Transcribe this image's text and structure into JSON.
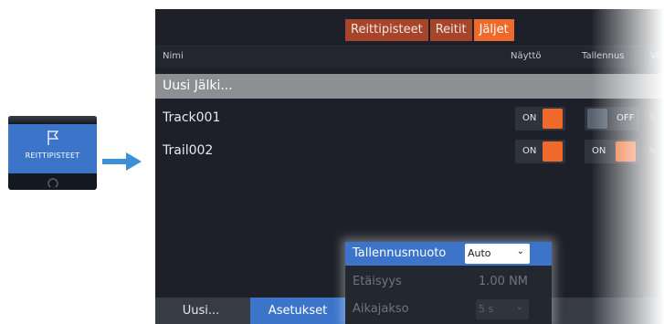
{
  "side_button": {
    "label": "REITTIPISTEET",
    "icon": "flag-icon",
    "accent": "#3b74c9"
  },
  "tabs": [
    {
      "label": "Reittipisteet",
      "active": false
    },
    {
      "label": "Reitit",
      "active": false
    },
    {
      "label": "Jäljet",
      "active": true
    }
  ],
  "columns": {
    "name": "Nimi",
    "display": "Näyttö",
    "recording": "Tallennus",
    "color": "Vä"
  },
  "new_track_label": "Uusi Jälki...",
  "tracks": [
    {
      "name": "Track001",
      "display": "ON",
      "recording": "OFF"
    },
    {
      "name": "Trail002",
      "display": "ON",
      "recording": "ON"
    }
  ],
  "bottom_bar": {
    "new_label": "Uusi...",
    "settings_label": "Asetukset"
  },
  "settings_popup": {
    "mode_label": "Tallennusmuoto",
    "mode_value": "Auto",
    "distance_label": "Etäisyys",
    "distance_value": "1.00 NM",
    "period_label": "Aikajakso",
    "period_value": "5 s"
  },
  "colors": {
    "on": "#ef6a2a",
    "off": "#56626f",
    "tab_active": "#ef6a2a",
    "tab_inactive": "#a7452b",
    "selection": "#3b74c9"
  }
}
